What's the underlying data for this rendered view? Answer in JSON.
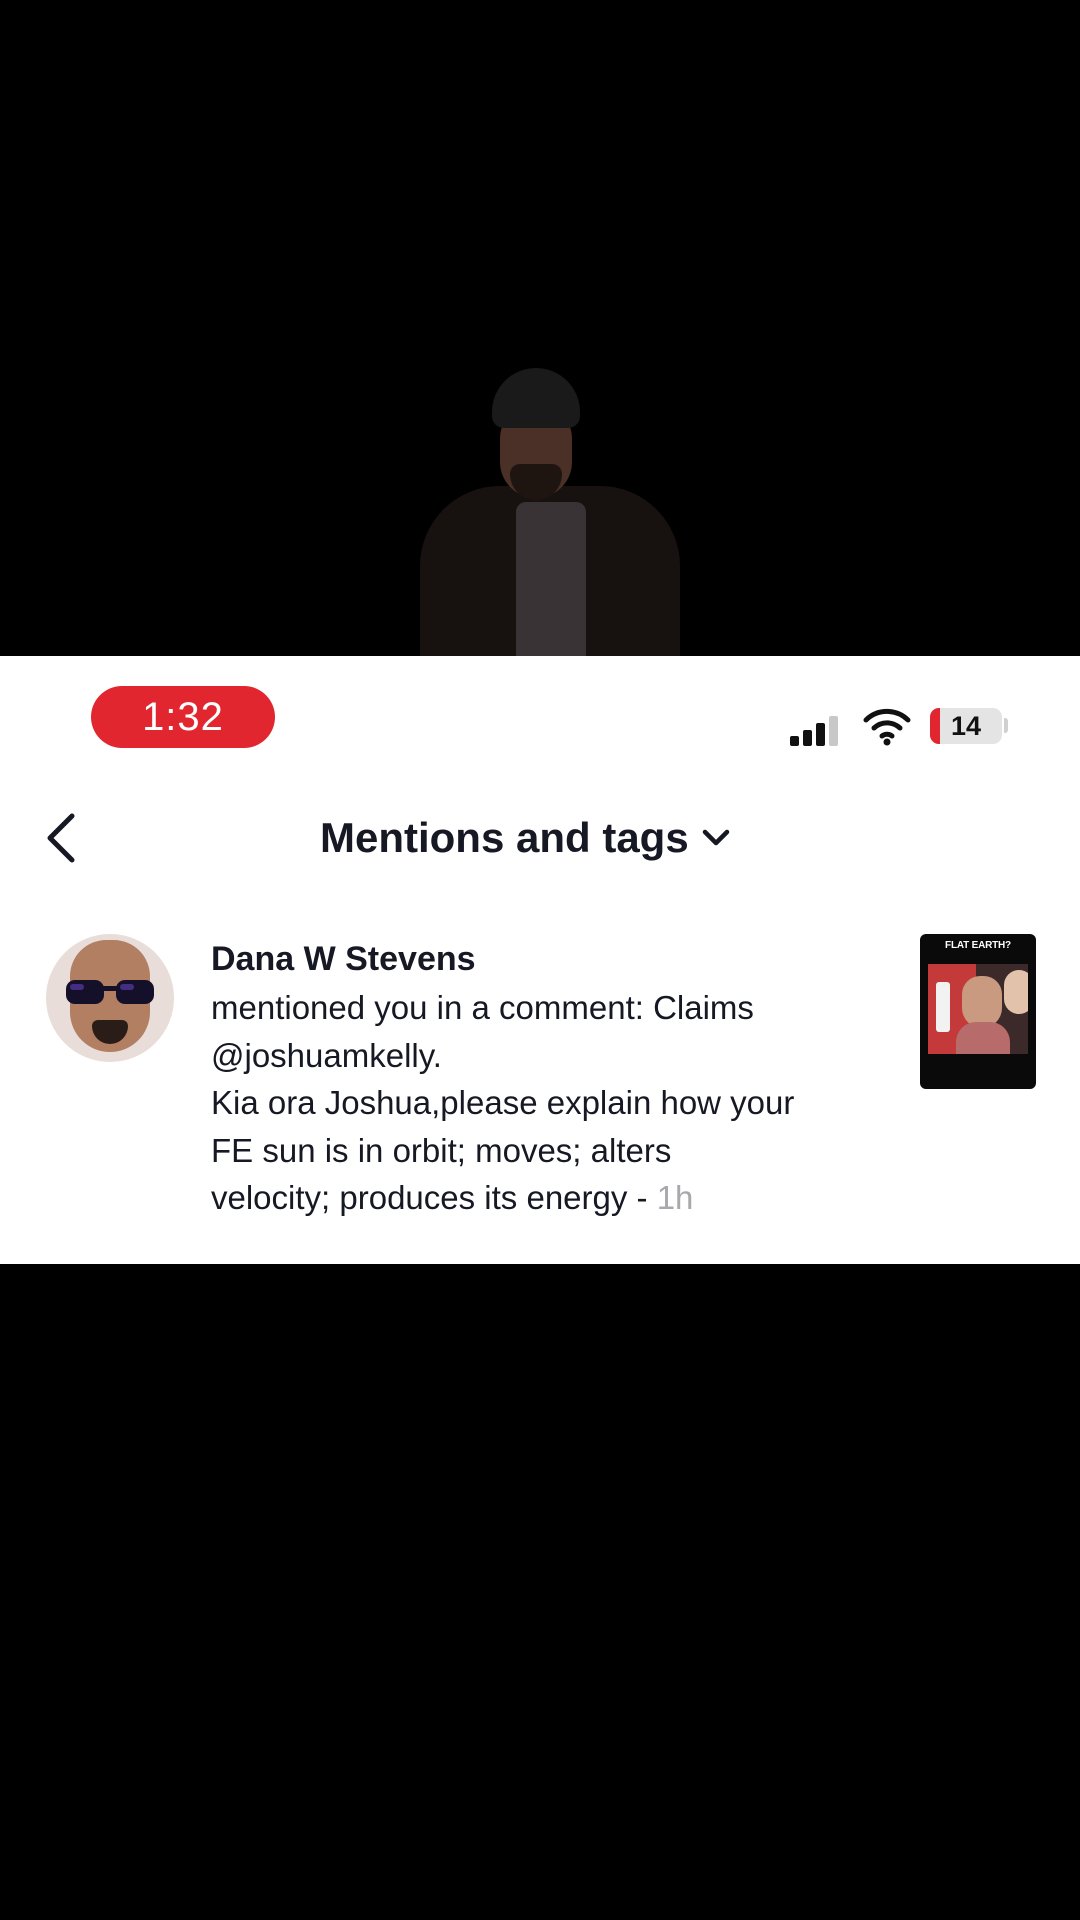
{
  "status_bar": {
    "time": "1:32",
    "battery_level": "14",
    "battery_fraction": 0.14,
    "signal_icon": "cellular-signal-icon",
    "wifi_icon": "wifi-icon"
  },
  "header": {
    "title": "Mentions and tags",
    "back_icon": "chevron-left-icon",
    "dropdown_icon": "chevron-down-icon"
  },
  "notification": {
    "username": "Dana W Stevens",
    "message_lines": [
      "mentioned you in a comment: Claims",
      "@joshuamkelly.",
      "Kia ora Joshua,please explain how your",
      "FE sun is in orbit; moves; alters",
      "velocity; produces its energy - "
    ],
    "time_ago": "1h",
    "thumbnail_caption": "FLAT EARTH?"
  },
  "colors": {
    "time_pill": "#e1262f",
    "text_primary": "#161823",
    "text_muted": "#a8a8ad",
    "panel_bg": "#ffffff",
    "page_bg": "#000000"
  }
}
